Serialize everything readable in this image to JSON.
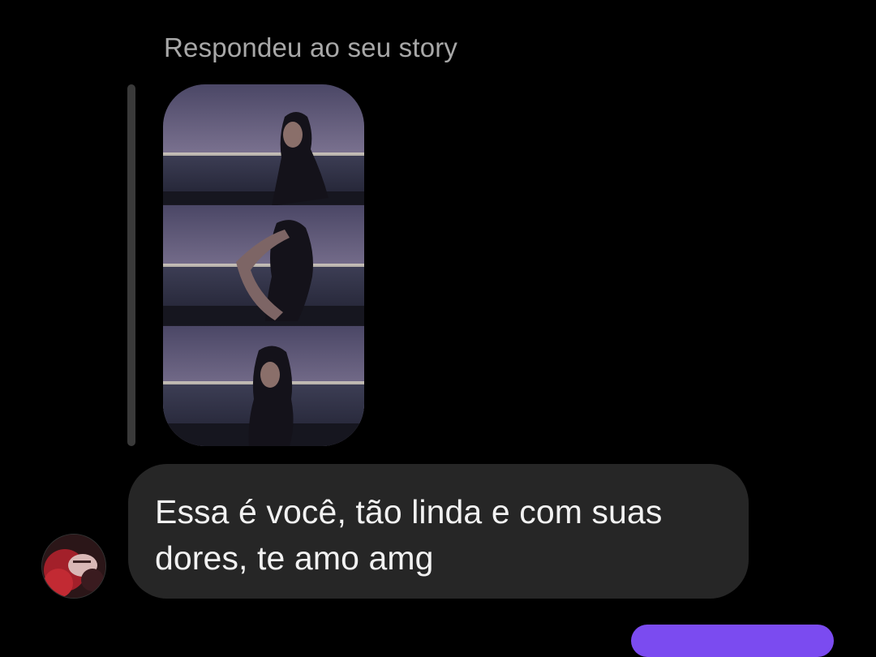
{
  "thread": {
    "reply_caption": "Respondeu ao seu story",
    "story": {
      "frames": 3
    },
    "incoming_message": {
      "text": "Essa é você, tão linda e com suas dores, te amo amg"
    },
    "sender_avatar_icon": "avatar-photo-icon"
  },
  "colors": {
    "background": "#000000",
    "caption": "#a8a8a8",
    "bubble": "#262626",
    "bubble_text": "#f2f2f2",
    "quote_bar": "#3a3a3a",
    "outgoing_bubble_accent": "#7b4bf0"
  }
}
